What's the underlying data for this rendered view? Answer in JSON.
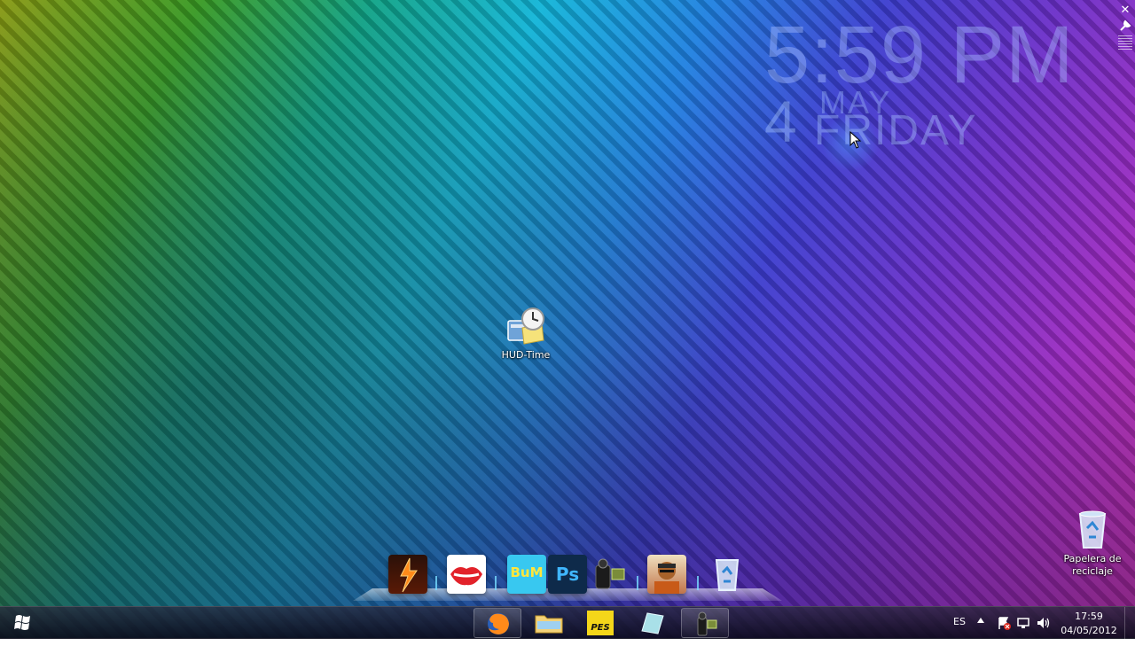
{
  "hud_clock": {
    "time": "5:59 PM",
    "day": "4",
    "month": "MAY",
    "weekday": "FRIDAY"
  },
  "desktop_icons": {
    "hud_time_label": "HUD-Time",
    "recycle_label_line1": "Papelera de",
    "recycle_label_line2": "reciclaje"
  },
  "dock": {
    "items": [
      "game-icon",
      "lips-icon",
      "bum-icon",
      "photoshop-icon",
      "camcorder-icon",
      "character-icon",
      "recycle-bin-icon"
    ],
    "photoshop_label": "Ps",
    "bum_label": "BuM"
  },
  "taskbar": {
    "pinned": [
      "firefox-icon",
      "folder-icon",
      "pes-icon",
      "note-icon",
      "camcorder-icon"
    ],
    "pes_label": "PES",
    "language": "ES",
    "clock_time": "17:59",
    "clock_date": "04/05/2012"
  },
  "colors": {
    "hud_text": "#aabeff",
    "taskbar": "#141428"
  }
}
